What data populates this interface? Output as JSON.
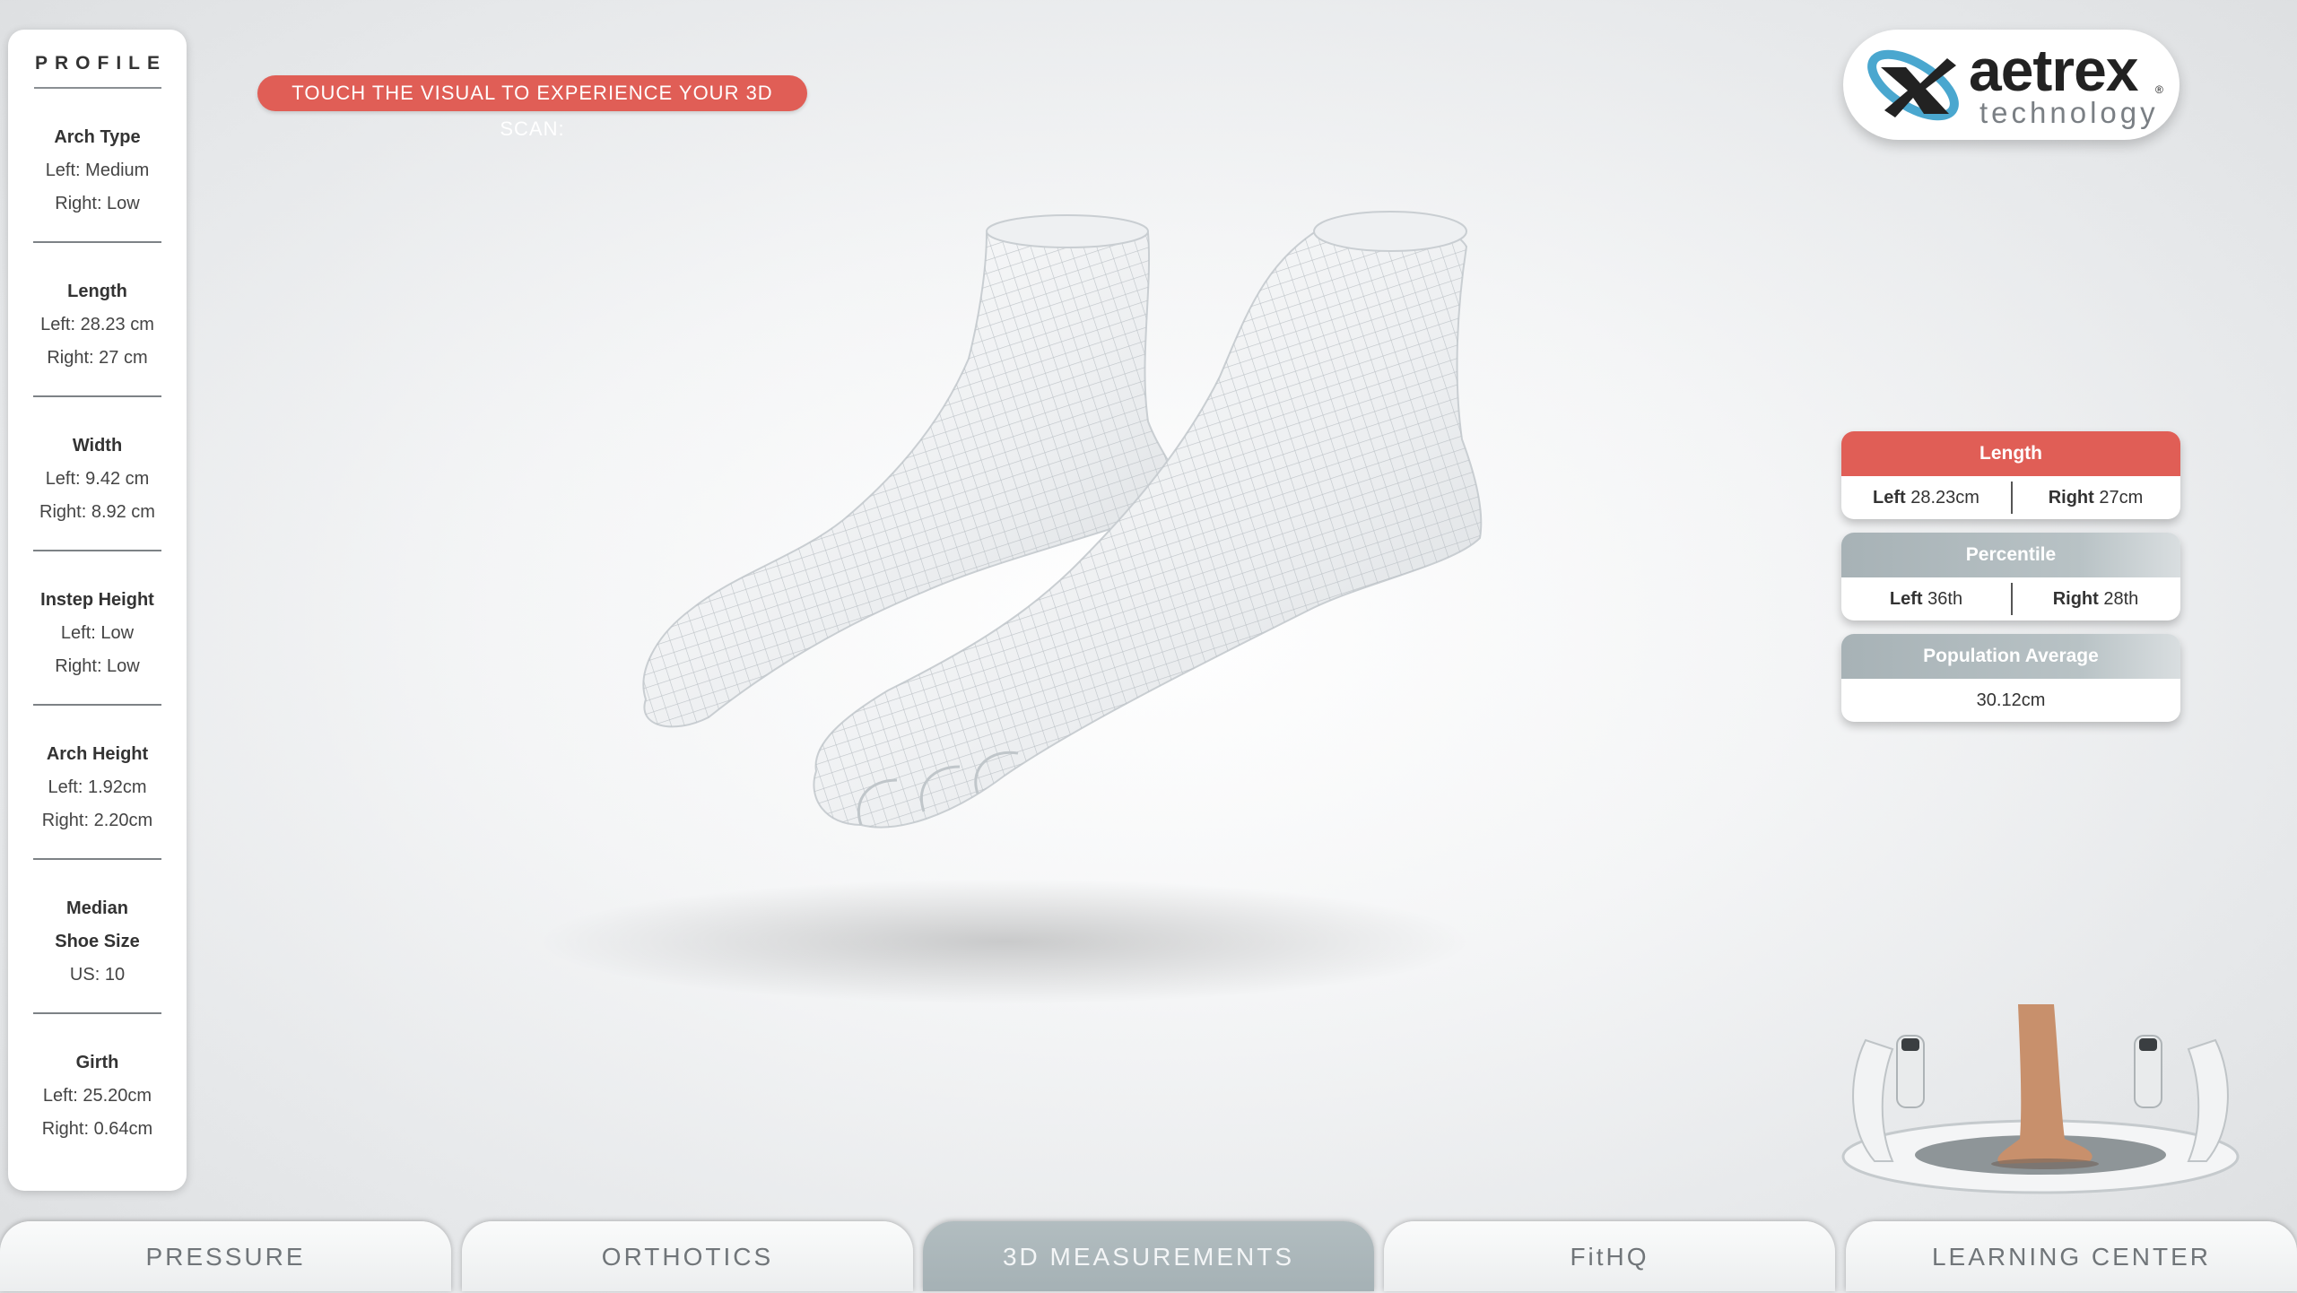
{
  "profile": {
    "title": "PROFILE",
    "metrics": [
      {
        "label": "Arch Type",
        "lines": [
          "Left: Medium",
          "Right: Low"
        ]
      },
      {
        "label": "Length",
        "lines": [
          "Left: 28.23 cm",
          "Right: 27 cm"
        ]
      },
      {
        "label": "Width",
        "lines": [
          "Left: 9.42 cm",
          "Right: 8.92 cm"
        ]
      },
      {
        "label": "Instep Height",
        "lines": [
          "Left: Low",
          "Right: Low"
        ]
      },
      {
        "label": "Arch Height",
        "lines": [
          "Left: 1.92cm",
          "Right: 2.20cm"
        ]
      },
      {
        "label": "Median",
        "lines": [
          "Shoe Size",
          "US: 10"
        ]
      },
      {
        "label": "Girth",
        "lines": [
          "Left: 25.20cm",
          "Right: 0.64cm"
        ]
      }
    ]
  },
  "prompt": "TOUCH THE VISUAL TO EXPERIENCE YOUR 3D SCAN:",
  "logo": {
    "brand": "aetrex",
    "reg": "®",
    "sub": "technology"
  },
  "cards": {
    "length": {
      "title": "Length",
      "left_label": "Left",
      "left_value": "28.23cm",
      "right_label": "Right",
      "right_value": "27cm"
    },
    "percentile": {
      "title": "Percentile",
      "left_label": "Left",
      "left_value": "36th",
      "right_label": "Right",
      "right_value": "28th"
    },
    "population": {
      "title": "Population Average",
      "value": "30.12cm"
    }
  },
  "tabs": [
    "PRESSURE",
    "ORTHOTICS",
    "3D MEASUREMENTS",
    "FitHQ",
    "LEARNING CENTER"
  ],
  "active_tab": "3D MEASUREMENTS",
  "colors": {
    "accent_red": "#e05e56",
    "card_gray": "#a7b2b6",
    "active_tab": "#aab5b9"
  },
  "icons": [
    "aetrex-logo-icon",
    "foot-scan-model",
    "scanner-device-image"
  ]
}
